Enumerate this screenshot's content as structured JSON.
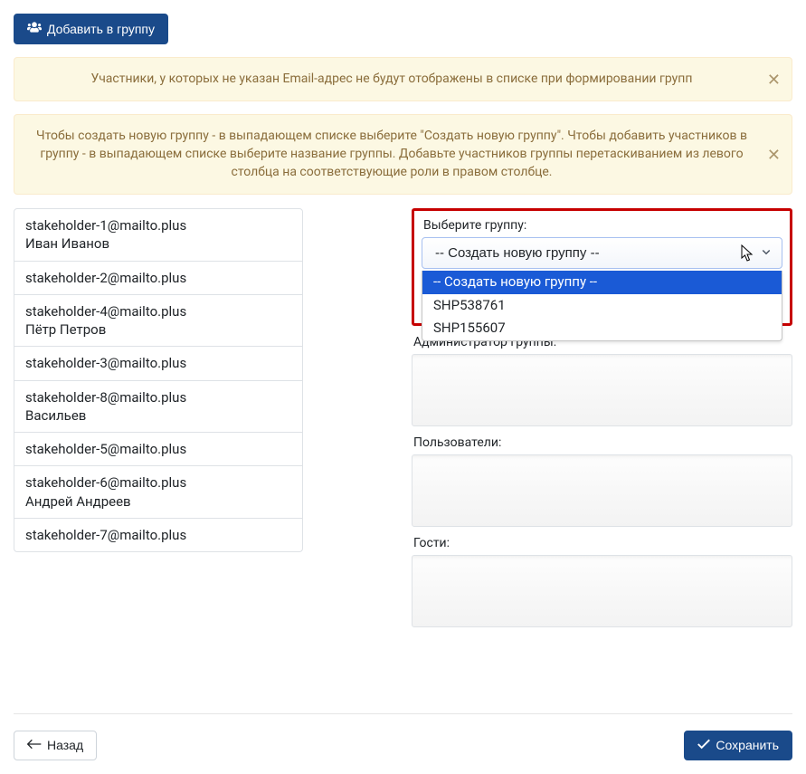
{
  "buttons": {
    "add_to_group": "Добавить в группу",
    "back": "Назад",
    "save": "Сохранить"
  },
  "alerts": {
    "email_warning": "Участники, у которых не указан Email-адрес не будут отображены в списке при формировании групп",
    "create_help": "Чтобы создать новую группу - в выпадающем списке выберите \"Создать новую группу\". Чтобы добавить участников в группу - в выпадающем списке выберите название группы. Добавьте участников группы перетаскиванием из левого столбца на соответствующие роли в правом столбце."
  },
  "stakeholders": [
    {
      "email": "stakeholder-1@mailto.plus",
      "name": "Иван Иванов"
    },
    {
      "email": "stakeholder-2@mailto.plus",
      "name": ""
    },
    {
      "email": "stakeholder-4@mailto.plus",
      "name": "Пётр Петров"
    },
    {
      "email": "stakeholder-3@mailto.plus",
      "name": ""
    },
    {
      "email": "stakeholder-8@mailto.plus",
      "name": "Васильев"
    },
    {
      "email": "stakeholder-5@mailto.plus",
      "name": ""
    },
    {
      "email": "stakeholder-6@mailto.plus",
      "name": "Андрей Андреев"
    },
    {
      "email": "stakeholder-7@mailto.plus",
      "name": ""
    }
  ],
  "right": {
    "select_group_label": "Выберите группу:",
    "select_value": "-- Создать новую группу --",
    "options": [
      "-- Создать новую группу --",
      "SHP538761",
      "SHP155607"
    ],
    "admin_label": "Администратор группы:",
    "users_label": "Пользователи:",
    "guests_label": "Гости:"
  }
}
